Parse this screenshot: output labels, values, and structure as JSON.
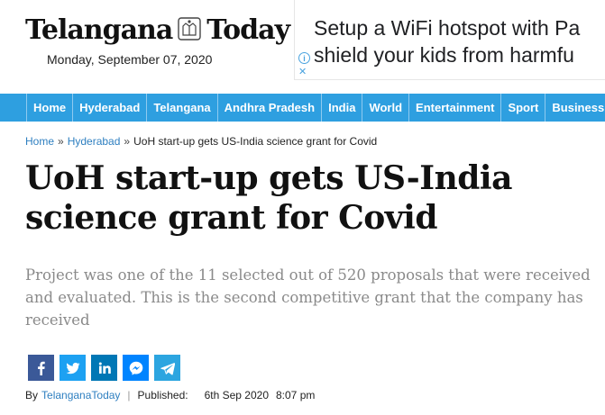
{
  "masthead": {
    "logo_left": "Telangana",
    "logo_right": "Today",
    "date": "Monday, September 07, 2020"
  },
  "ad": {
    "line1": "Setup a WiFi hotspot with Pa",
    "line2": "shield your kids from harmfu",
    "info_glyph": "i",
    "close_glyph": "✕"
  },
  "nav": {
    "items": [
      "Home",
      "Hyderabad",
      "Telangana",
      "Andhra Pradesh",
      "India",
      "World",
      "Entertainment",
      "Sport",
      "Business"
    ]
  },
  "breadcrumb": {
    "home": "Home",
    "separator": "»",
    "section": "Hyderabad",
    "current": "UoH start-up gets US-India science grant for Covid"
  },
  "article": {
    "title": "UoH start-up gets US-India science grant for Covid",
    "summary": "Project was one of the 11 selected out of 520 proposals that were received and evaluated. This is the second competitive grant that the company has received"
  },
  "share": {
    "buttons": [
      {
        "icon": "facebook-icon",
        "color": "#3b5998"
      },
      {
        "icon": "twitter-icon",
        "color": "#1da1f2"
      },
      {
        "icon": "linkedin-icon",
        "color": "#0077b5"
      },
      {
        "icon": "messenger-icon",
        "color": "#0084ff"
      },
      {
        "icon": "telegram-icon",
        "color": "#2ca5e0"
      }
    ]
  },
  "byline": {
    "by": "By",
    "author": "TelanganaToday",
    "pipe": "|",
    "published_label": "Published:",
    "date": "6th Sep 2020",
    "time": "8:07 pm"
  },
  "colors": {
    "nav_bg": "#2e9fe0",
    "link": "#2e7fc0",
    "summary": "#8a8a8a"
  }
}
